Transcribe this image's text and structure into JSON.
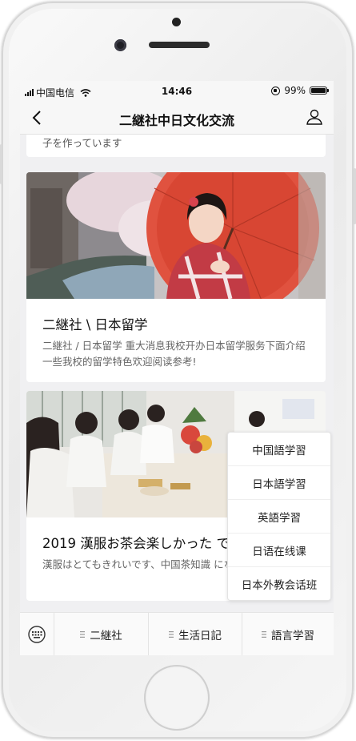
{
  "status_bar": {
    "carrier": "中国电信",
    "time": "14:46",
    "battery": "99%"
  },
  "nav": {
    "title": "二継社中日文化交流"
  },
  "feed": {
    "top_card_desc": "子を作っています",
    "cards": [
      {
        "title": "二継社 \\ 日本留学",
        "desc": "二継社 / 日本留学 重大消息我校开办日本留学服务下面介绍一些我校的留学特色欢迎阅读参考!"
      },
      {
        "title": "2019 漢服お茶会楽しかった です",
        "desc": "漢服はとてもきれいです、中国茶知識 になりました。"
      }
    ]
  },
  "popup_menu": {
    "items": [
      "中国語学習",
      "日本語学習",
      "英語学習",
      "日语在线课",
      "日本外教会话班"
    ]
  },
  "tab_bar": {
    "tabs": [
      "二継社",
      "生活日記",
      "語言学習"
    ]
  },
  "icons": {
    "back": "chevron-left-icon",
    "user": "user-icon",
    "keyboard": "keyboard-icon",
    "menu": "menu-lines-icon"
  }
}
